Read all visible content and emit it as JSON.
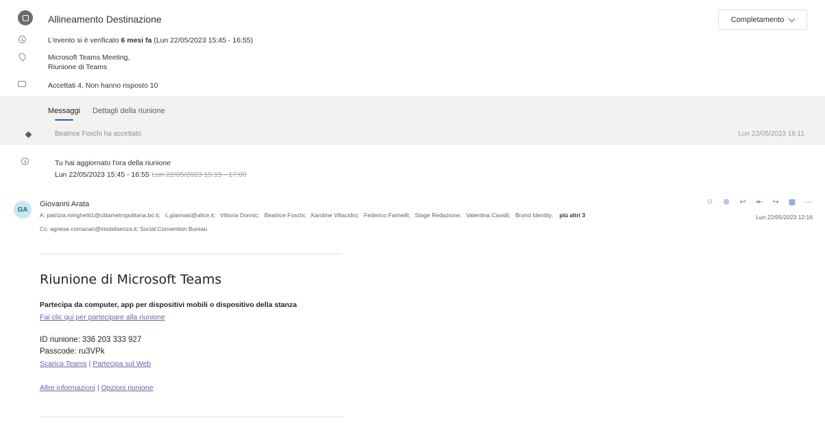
{
  "header": {
    "title": "Allineamento Destinazione",
    "status_button": "Completamento"
  },
  "info": {
    "time_prefix": "L'evento si è verificato ",
    "time_bold": "6 mesi fa",
    "time_suffix": " (Lun 22/05/2023 15:45 - 16:55)",
    "location_line1": "Microsoft Teams Meeting,",
    "location_line2": "Riunione di Teams",
    "attendees": "Accettati 4, Non hanno risposto 10"
  },
  "tabs": [
    {
      "label": "Messaggi"
    },
    {
      "label": "Dettagli della riunione"
    }
  ],
  "band_row": {
    "text": "Beatrice Foschi ha accettato",
    "date": "Lun 22/05/2023 16:11"
  },
  "update": {
    "title": "Tu hai aggiornato l'ora della riunione",
    "new_time": "Lun 22/05/2023 15:45 - 16:55",
    "old_time": "Lun 22/05/2023 15:15 - 17:00"
  },
  "message": {
    "avatar": "GA",
    "sender": "Giovanni Arata",
    "to_label": "A:",
    "recipients": [
      "patrizia.minghetti1@cittametropolitana.bo.it;",
      "c.giannasi@alice.it;",
      "Vittoria Donnic;",
      "Beatrice Foschi;",
      "Karoline Villacidro;",
      "Federico Farinelli;",
      "Stage Redazione;",
      "Valentina Cavalli;",
      "Brand Identity;"
    ],
    "more": "più altri 3",
    "cc_label": "Cc:",
    "cc": "agnese.cornacari@imolafaenza.it;  Social Convention Bureau",
    "date": "Lun 22/05/2023 12:16"
  },
  "body": {
    "meeting_title": "Riunione di Microsoft Teams",
    "join_heading": "Partecipa da computer, app per dispositivi mobili o dispositivo della stanza",
    "join_link": "Fai clic qui per partecipare alla riunione",
    "meeting_id": "ID riunione: 336 203 333 927",
    "passcode": "Passcode: ru3VPk",
    "download_link": "Scarica Teams",
    "web_link": "Partecipa sul Web",
    "more_info_link": "Altre informazioni",
    "options_link": "Opzioni riunione",
    "separator": " | "
  }
}
